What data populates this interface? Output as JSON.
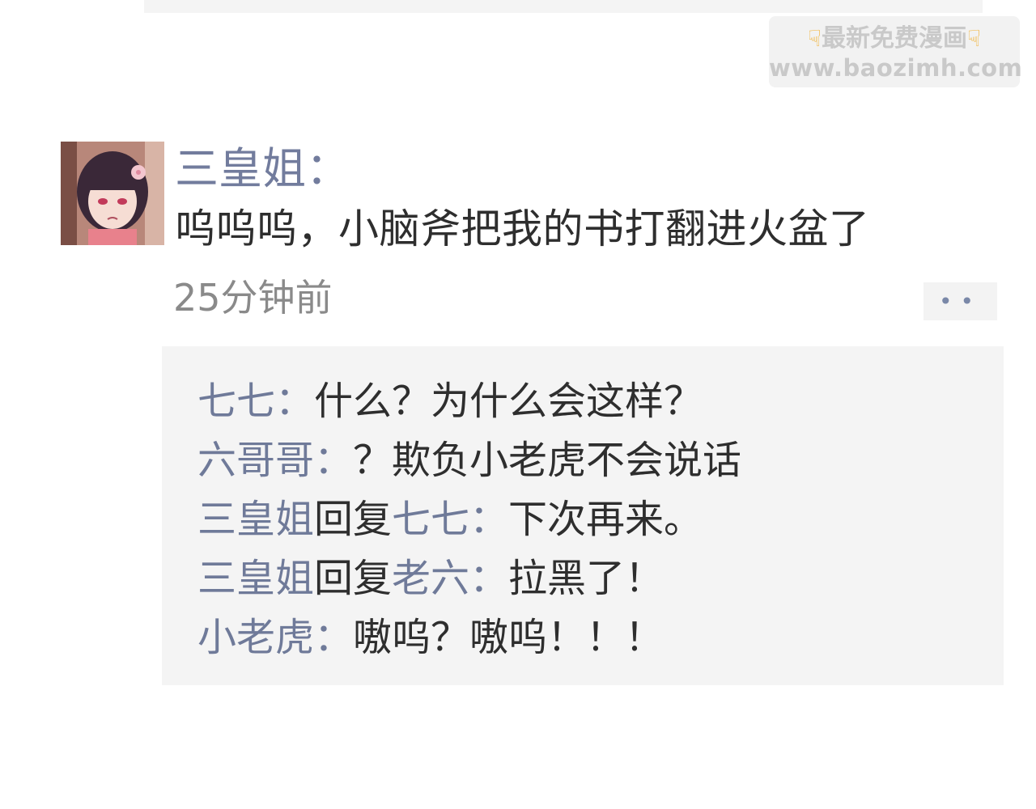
{
  "watermark": {
    "left_icon": "pointing-down-hand-icon",
    "title": "最新免费漫画",
    "right_icon": "pointing-down-hand-icon",
    "url": "www.baozimh.com"
  },
  "post": {
    "author": "三皇姐：",
    "text": "呜呜呜，小脑斧把我的书打翻进火盆了",
    "time": "25分钟前",
    "more_label": "••"
  },
  "replies": [
    {
      "name": "七七：",
      "text": "什么？为什么会这样？"
    },
    {
      "name": "六哥哥：",
      "text": "？欺负小老虎不会说话"
    },
    {
      "name": "三皇姐",
      "connector": "回复",
      "target": "七七：",
      "text": "下次再来。"
    },
    {
      "name": "三皇姐",
      "connector": "回复",
      "target": "老六：",
      "text": "拉黑了！"
    },
    {
      "name": "小老虎：",
      "text": "嗷呜？嗷呜！！！"
    }
  ],
  "colors": {
    "name": "#6f7a99",
    "text": "#2e2e2e",
    "time": "#8a8a8a",
    "reply_bg": "#f4f4f4"
  }
}
